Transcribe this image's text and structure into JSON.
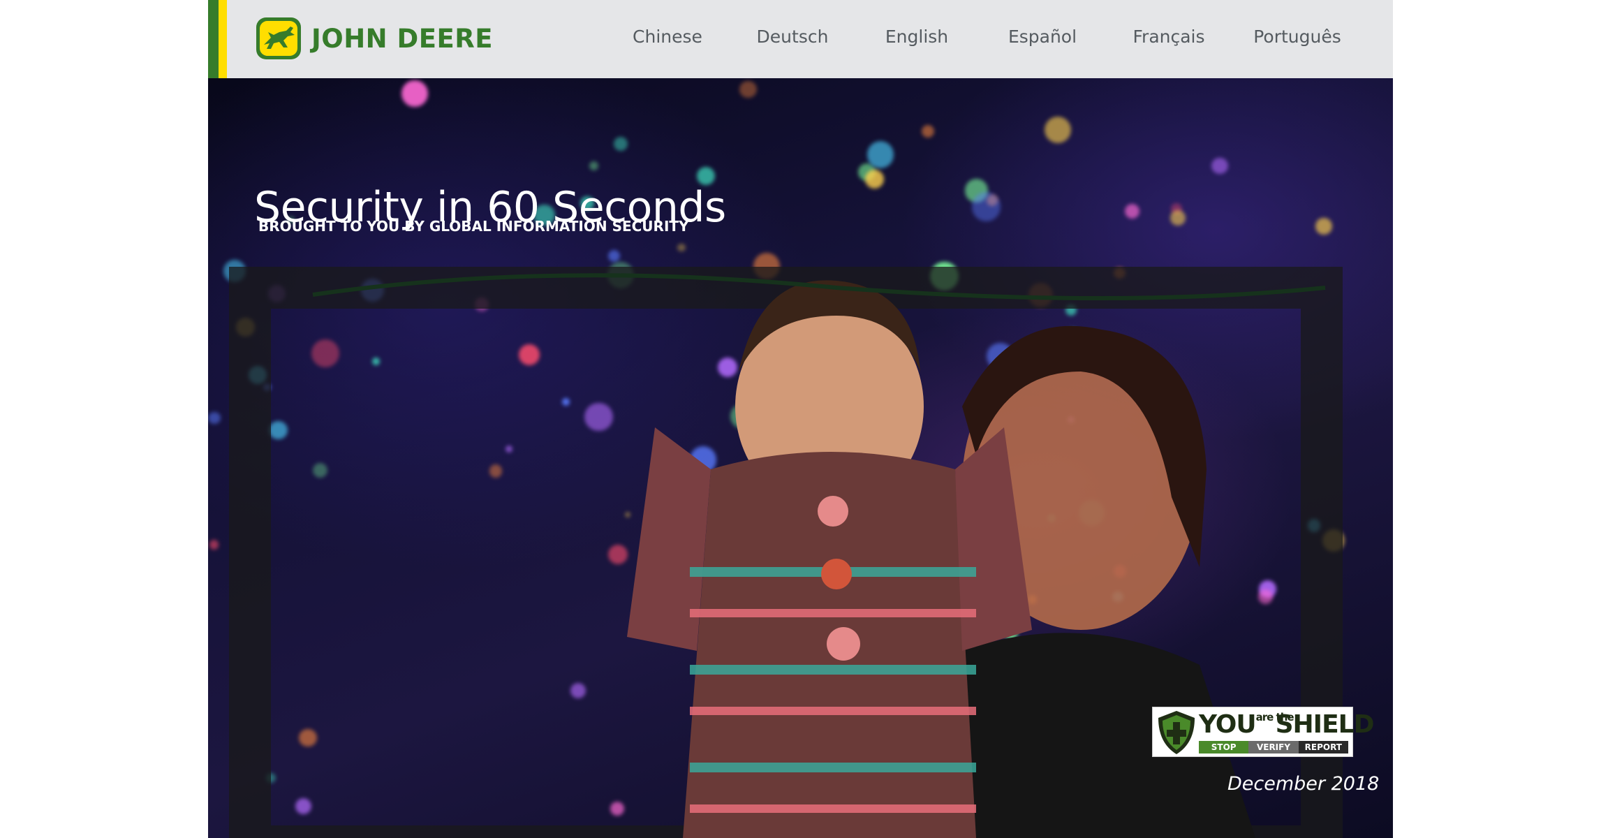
{
  "brand": {
    "name": "JOHN DEERE",
    "green": "#367c2b",
    "yellow": "#ffde00",
    "logo_icon": "leaping-deer-icon"
  },
  "nav": {
    "languages": [
      "Chinese",
      "Deutsch",
      "English",
      "Español",
      "Français",
      "Português"
    ]
  },
  "hero": {
    "title": "Security in 60 Seconds",
    "subtitle": "BROUGHT TO YOU BY GLOBAL INFORMATION SECURITY",
    "image_subject": "child-and-woman-with-holiday-lights-photo"
  },
  "badge": {
    "you": "YOU",
    "are_the": "are the",
    "shield": "SHIELD",
    "stop": "STOP",
    "verify": "VERIFY",
    "report": "REPORT",
    "icon": "shield-cross-icon"
  },
  "date": "December 2018"
}
